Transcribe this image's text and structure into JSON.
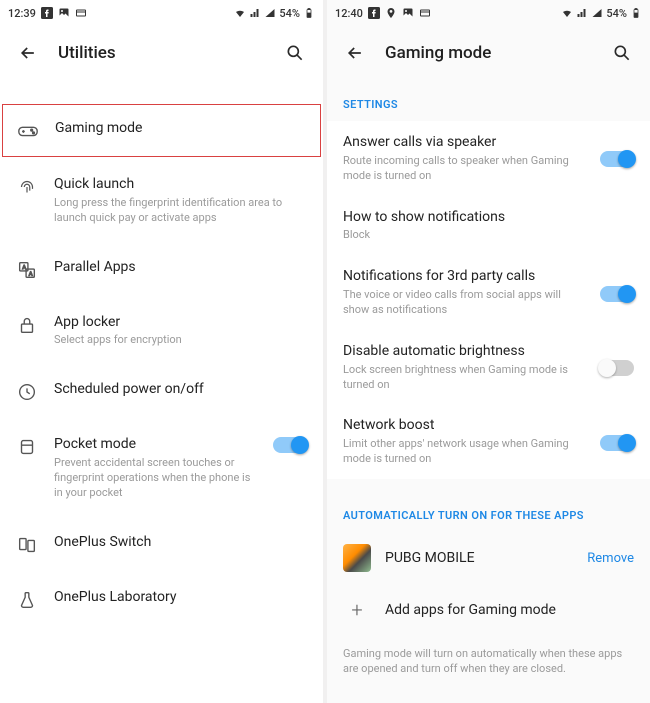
{
  "left": {
    "status": {
      "time": "12:39",
      "battery": "54%"
    },
    "header": {
      "title": "Utilities"
    },
    "items": [
      {
        "title": "Gaming mode",
        "sub": ""
      },
      {
        "title": "Quick launch",
        "sub": "Long press the fingerprint identification area to launch quick pay or activate apps"
      },
      {
        "title": "Parallel Apps",
        "sub": ""
      },
      {
        "title": "App locker",
        "sub": "Select apps for encryption"
      },
      {
        "title": "Scheduled power on/off",
        "sub": ""
      },
      {
        "title": "Pocket mode",
        "sub": "Prevent accidental screen touches or fingerprint operations when the phone is in your pocket"
      },
      {
        "title": "OnePlus Switch",
        "sub": ""
      },
      {
        "title": "OnePlus Laboratory",
        "sub": ""
      }
    ]
  },
  "right": {
    "status": {
      "time": "12:40",
      "battery": "54%"
    },
    "header": {
      "title": "Gaming mode"
    },
    "section_settings": "SETTINGS",
    "settings": [
      {
        "title": "Answer calls via speaker",
        "sub": "Route incoming calls to speaker when Gaming mode is turned on"
      },
      {
        "title": "How to show notifications",
        "sub": "Block"
      },
      {
        "title": "Notifications for 3rd party calls",
        "sub": "The voice or video calls from social apps will show as notifications"
      },
      {
        "title": "Disable automatic brightness",
        "sub": "Lock screen brightness when Gaming mode is turned on"
      },
      {
        "title": "Network boost",
        "sub": "Limit other apps' network usage when Gaming mode is turned on"
      }
    ],
    "section_apps": "AUTOMATICALLY TURN ON FOR THESE APPS",
    "app": {
      "name": "PUBG MOBILE",
      "remove": "Remove"
    },
    "add_label": "Add apps for Gaming mode",
    "footnote": "Gaming mode will turn on automatically when these apps are opened and turn off when they are closed."
  }
}
